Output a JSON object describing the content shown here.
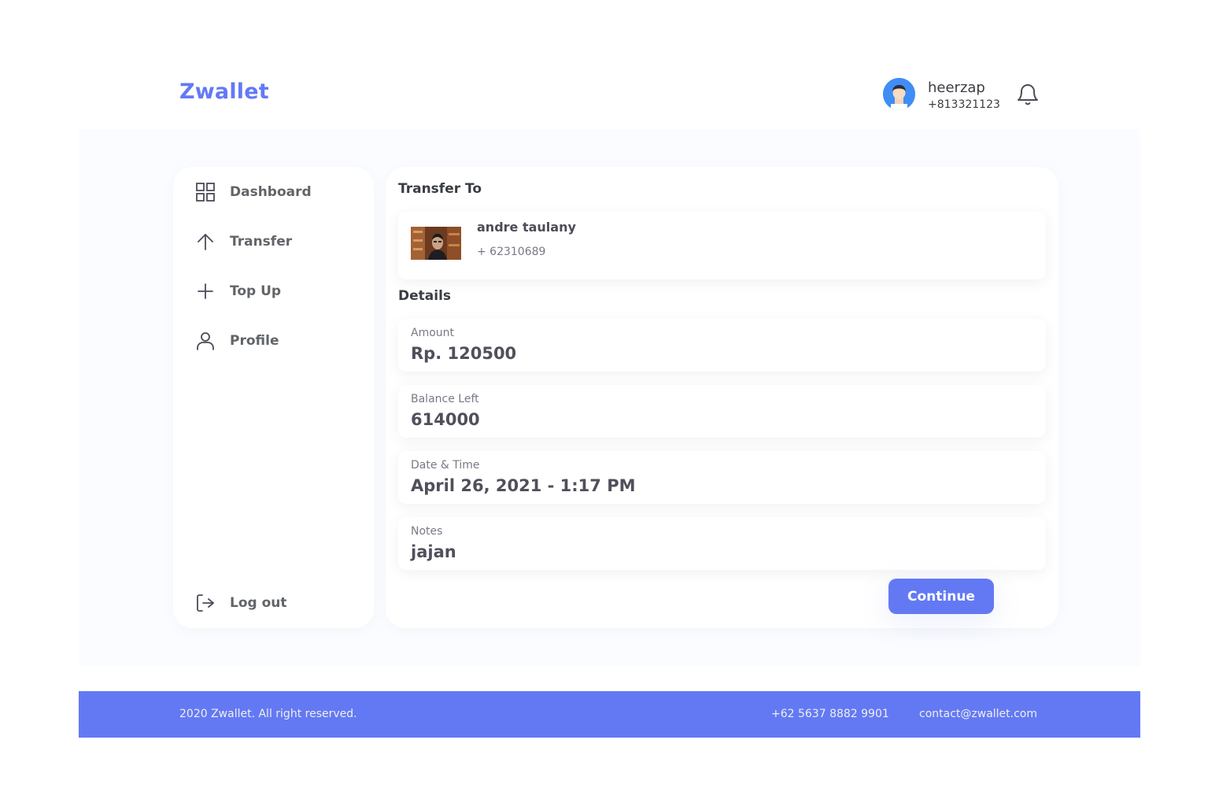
{
  "app": {
    "brand": "Zwallet"
  },
  "user": {
    "name": "heerzap",
    "phone": "+813321123"
  },
  "sidebar": {
    "items": [
      {
        "label": "Dashboard",
        "icon": "grid-icon"
      },
      {
        "label": "Transfer",
        "icon": "arrow-up-icon"
      },
      {
        "label": "Top Up",
        "icon": "plus-icon"
      },
      {
        "label": "Profile",
        "icon": "user-icon"
      }
    ],
    "logout": {
      "label": "Log out",
      "icon": "logout-icon"
    }
  },
  "transfer": {
    "section_title": "Transfer To",
    "receiver": {
      "name": "andre taulany",
      "phone": "+ 62310689"
    },
    "details_title": "Details",
    "details": [
      {
        "label": "Amount",
        "value": "Rp. 120500"
      },
      {
        "label": "Balance Left",
        "value": "614000"
      },
      {
        "label": "Date & Time",
        "value": "April 26, 2021 - 1:17 PM"
      },
      {
        "label": "Notes",
        "value": "jajan"
      }
    ],
    "continue_label": "Continue"
  },
  "footer": {
    "copyright": "2020 Zwallet. All right reserved.",
    "phone": "+62 5637 8882 9901",
    "email": "contact@zwallet.com"
  },
  "colors": {
    "accent": "#6379f4",
    "background": "#fafcff",
    "text": "#3a3d42"
  }
}
